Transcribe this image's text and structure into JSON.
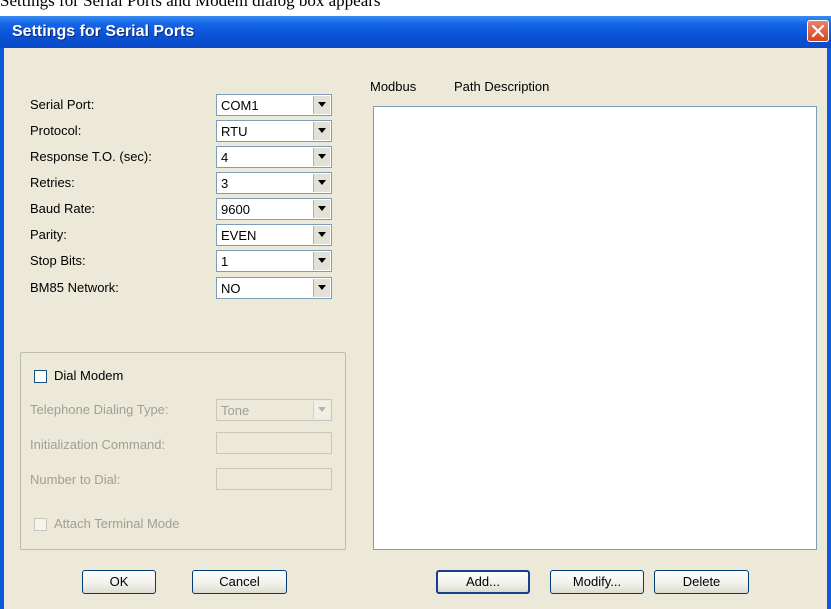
{
  "caption_text": "Settings for Serial Ports and Modem dialog box appears",
  "dialog": {
    "title": "Settings for Serial Ports",
    "fields": [
      {
        "label": "Serial Port:",
        "value": "COM1"
      },
      {
        "label": "Protocol:",
        "value": "RTU"
      },
      {
        "label": "Response T.O. (sec):",
        "value": "4"
      },
      {
        "label": "Retries:",
        "value": "3"
      },
      {
        "label": "Baud Rate:",
        "value": "9600"
      },
      {
        "label": "Parity:",
        "value": "EVEN"
      },
      {
        "label": "Stop Bits:",
        "value": "1"
      },
      {
        "label": "BM85 Network:",
        "value": "NO"
      }
    ],
    "modem": {
      "dial_modem_label": "Dial Modem",
      "dial_modem_checked": false,
      "dialing_type_label": "Telephone Dialing Type:",
      "dialing_type_value": "Tone",
      "init_command_label": "Initialization Command:",
      "init_command_value": "",
      "number_label": "Number to Dial:",
      "number_value": "",
      "attach_terminal_label": "Attach Terminal Mode",
      "attach_terminal_checked": false
    },
    "list": {
      "col_modbus": "Modbus",
      "col_path": "Path Description",
      "rows": []
    },
    "buttons": {
      "ok": "OK",
      "cancel": "Cancel",
      "add": "Add...",
      "modify": "Modify...",
      "delete": "Delete"
    }
  }
}
